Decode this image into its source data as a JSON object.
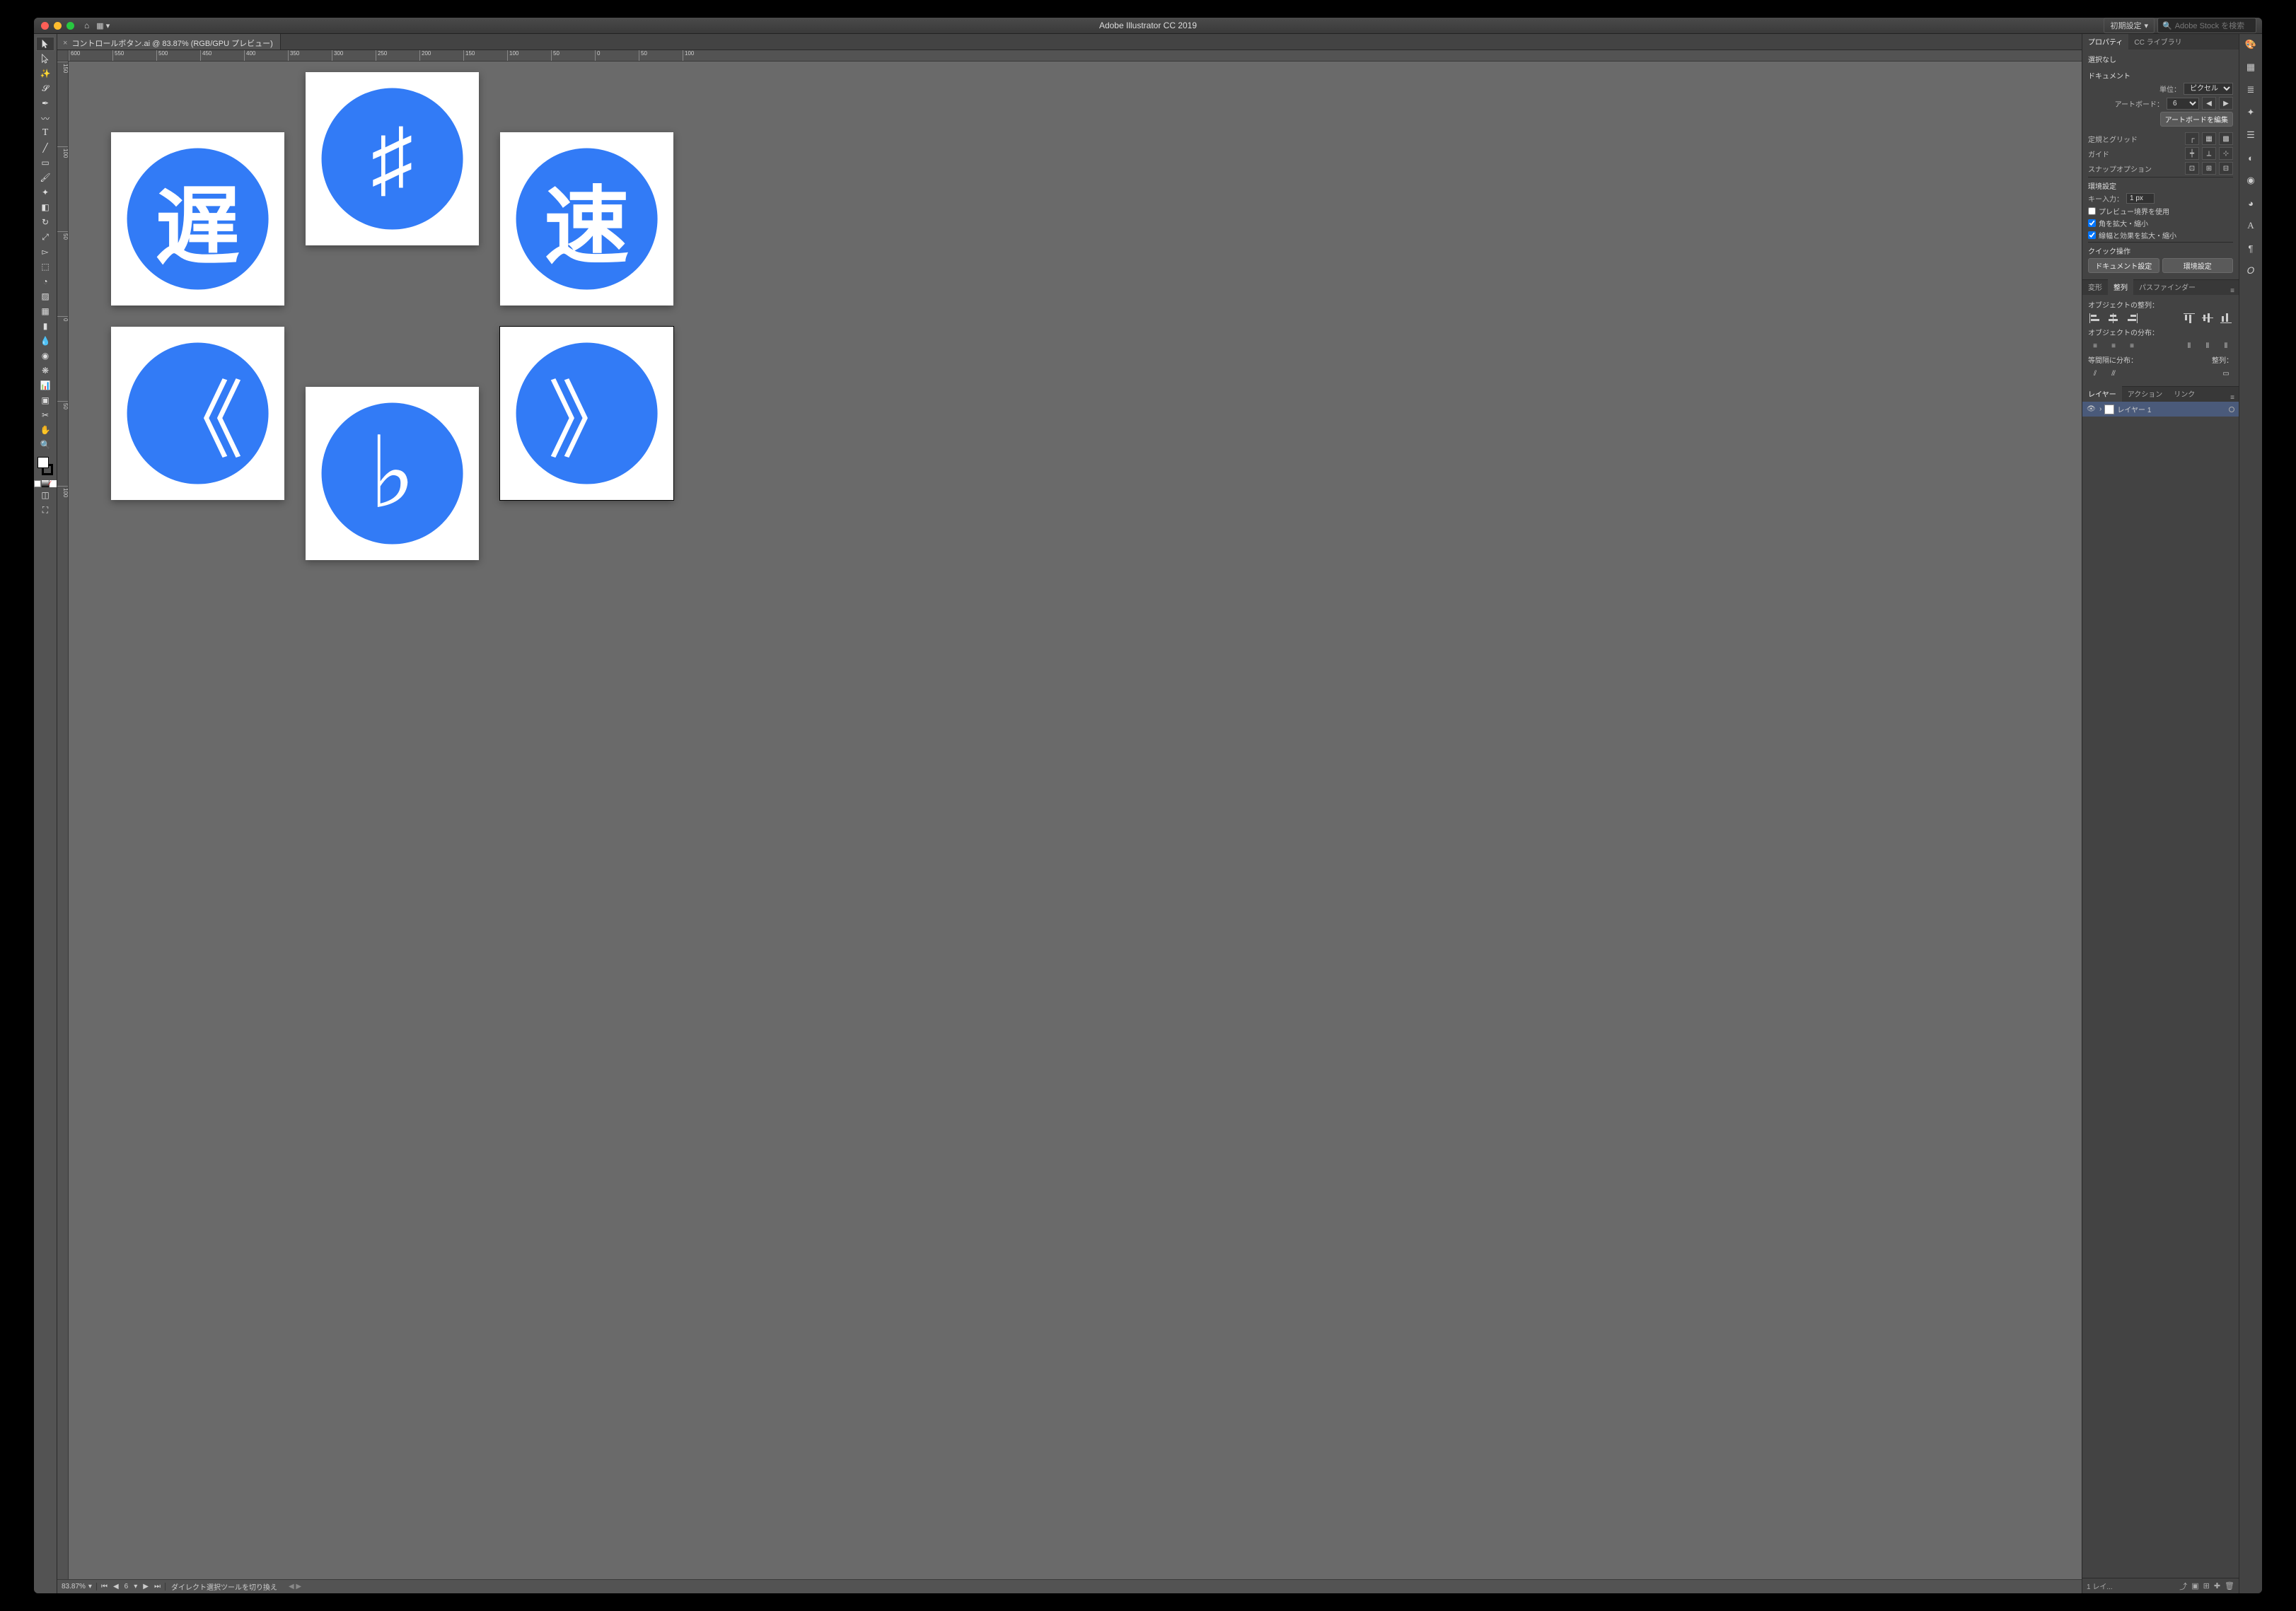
{
  "app_title": "Adobe Illustrator CC 2019",
  "preset_label": "初期設定",
  "stock_placeholder": "Adobe Stock を検索",
  "doc_tab": "コントロールボタン.ai @ 83.87% (RGB/GPU プレビュー)",
  "ruler_h": [
    "600",
    "550",
    "500",
    "450",
    "400",
    "350",
    "300",
    "250",
    "200",
    "150",
    "100",
    "50",
    "0",
    "50",
    "100"
  ],
  "ruler_v": [
    "150",
    "100",
    "50",
    "0",
    "50",
    "100"
  ],
  "artboards": {
    "a1": "遅",
    "a2": "♯",
    "a3": "速",
    "a4": "《",
    "a5": "♭",
    "a6": "》"
  },
  "status": {
    "zoom": "83.87%",
    "art_index": "6",
    "info": "ダイレクト選択ツールを切り換え"
  },
  "properties": {
    "tab_props": "プロパティ",
    "tab_ccl": "CC ライブラリ",
    "no_sel": "選択なし",
    "doc_sec": "ドキュメント",
    "unit_label": "単位：",
    "unit_value": "ピクセル",
    "artboard_label": "アートボード：",
    "artboard_value": "6",
    "edit_artboards": "アートボードを編集",
    "ruler_grid": "定規とグリッド",
    "guides": "ガイド",
    "snap": "スナップオプション",
    "prefs_sec": "環境設定",
    "key_input_label": "キー入力：",
    "key_input_value": "1 px",
    "chk_preview": "プレビュー境界を使用",
    "chk_corner": "角を拡大・縮小",
    "chk_stroke": "線幅と効果を拡大・縮小",
    "quick_sec": "クイック操作",
    "quick_btn1": "ドキュメント設定",
    "quick_btn2": "環境設定"
  },
  "align": {
    "tab_transform": "変形",
    "tab_align": "整列",
    "tab_pathfinder": "パスファインダー",
    "align_obj": "オブジェクトの整列：",
    "dist_obj": "オブジェクトの分布：",
    "dist_space": "等間隔に分布：",
    "align_to": "整列："
  },
  "layers": {
    "tab_layers": "レイヤー",
    "tab_actions": "アクション",
    "tab_links": "リンク",
    "layer1": "レイヤー 1",
    "footer_count": "1 レイ..."
  }
}
